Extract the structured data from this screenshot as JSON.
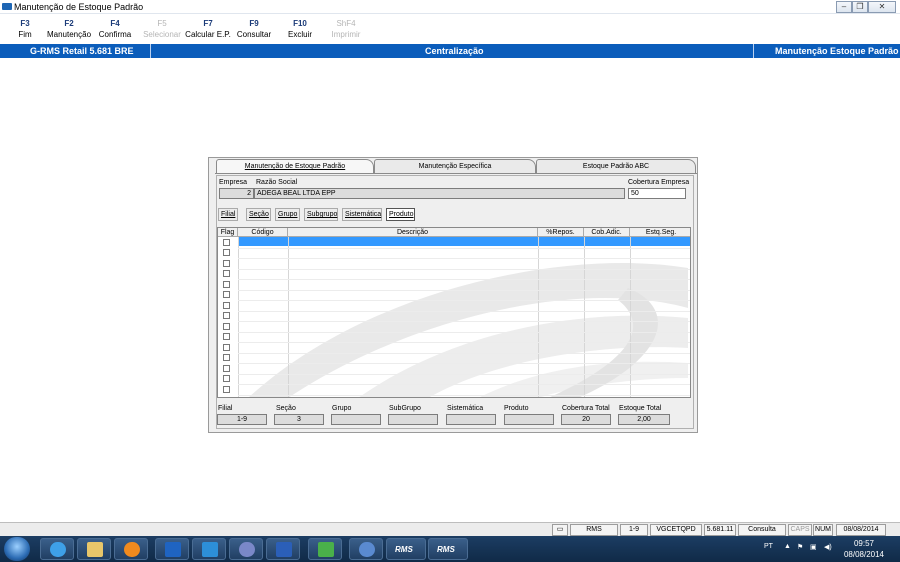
{
  "window": {
    "title": "Manutenção de Estoque Padrão",
    "controls": [
      "minimize-icon",
      "restore-icon",
      "close-icon"
    ]
  },
  "toolbar": [
    {
      "key": "F3",
      "label": "Fim",
      "enabled": true
    },
    {
      "key": "F2",
      "label": "Manutenção",
      "enabled": true
    },
    {
      "key": "F4",
      "label": "Confirma",
      "enabled": true
    },
    {
      "key": "F5",
      "label": "Selecionar",
      "enabled": false
    },
    {
      "key": "F7",
      "label": "Calcular E.P.",
      "enabled": true
    },
    {
      "key": "F9",
      "label": "Consultar",
      "enabled": true
    },
    {
      "key": "F10",
      "label": "Excluir",
      "enabled": true
    },
    {
      "key": "ShF4",
      "label": "Imprimir",
      "enabled": false
    }
  ],
  "infobar": {
    "left": "G-RMS Retail 5.681 BRE",
    "center": "Centralização",
    "right": "Manutenção Estoque Padrão"
  },
  "tabs": [
    {
      "label": "Manutenção de Estoque Padrão",
      "active": true
    },
    {
      "label": "Manutenção Específica",
      "active": false
    },
    {
      "label": "Estoque Padrão ABC",
      "active": false
    }
  ],
  "empresa": {
    "label_empresa": "Empresa",
    "empresa_value": "2",
    "label_razao": "Razão Social",
    "razao_value": "ADEGA BEAL LTDA EPP",
    "label_cobertura": "Cobertura Empresa",
    "cobertura_value": "50"
  },
  "filters": [
    "Filial",
    "Seção",
    "Grupo",
    "Subgrupo",
    "Sistemática",
    "Produto"
  ],
  "selected_filter": "Produto",
  "grid": {
    "columns": [
      "Flag",
      "Código",
      "Descrição",
      "%Repos.",
      "Cob.Adic.",
      "Estq.Seg."
    ],
    "row_count": 15,
    "selected_row": 0
  },
  "summary": [
    {
      "label": "Filial",
      "value": "1-9"
    },
    {
      "label": "Seção",
      "value": "3"
    },
    {
      "label": "Grupo",
      "value": ""
    },
    {
      "label": "SubGrupo",
      "value": ""
    },
    {
      "label": "Sistemática",
      "value": ""
    },
    {
      "label": "Produto",
      "value": ""
    },
    {
      "label": "Cobertura Total",
      "value": "20"
    },
    {
      "label": "Estoque Total",
      "value": "2,00"
    }
  ],
  "statusbar": [
    "RMS",
    "1-9",
    "VGCETQPD",
    "5.681.11",
    "Consulta",
    "CAPS",
    "NUM",
    "08/08/2014"
  ],
  "taskbar": {
    "lang": "PT",
    "time": "09:57",
    "date": "08/08/2014",
    "apps": [
      "ie-icon",
      "explorer-icon",
      "media-player-icon",
      "outlook-icon",
      "lync-icon",
      "network-icon",
      "word-icon",
      "app-icon",
      "fortinet-icon",
      "rms-icon",
      "rms-icon"
    ],
    "app_labels": {
      "rms1": "RMS",
      "rms2": "RMS"
    }
  },
  "colors": {
    "accent": "#0b5dbb",
    "selection": "#3399ff"
  }
}
